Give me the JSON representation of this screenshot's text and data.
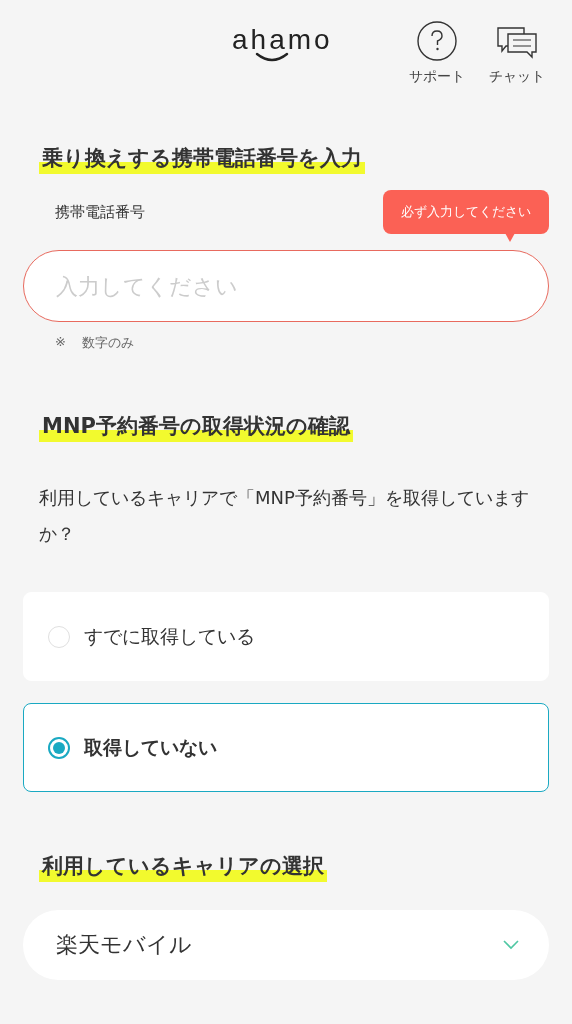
{
  "header": {
    "logo": "ahamo",
    "actions": [
      {
        "kind": "support",
        "label": "サポート"
      },
      {
        "kind": "chat",
        "label": "チャット"
      }
    ]
  },
  "phone_section": {
    "heading": "乗り換えする携帯電話番号を入力",
    "field_label": "携帯電話番号",
    "error_tooltip": "必ず入力してください",
    "placeholder": "入力してください",
    "note_mark": "※",
    "note": "数字のみ"
  },
  "mnp_section": {
    "heading": "MNP予約番号の取得状況の確認",
    "question": "利用しているキャリアで「MNP予約番号」を取得していますか？",
    "options": [
      {
        "label": "すでに取得している",
        "selected": false
      },
      {
        "label": "取得していない",
        "selected": true
      }
    ]
  },
  "carrier_section": {
    "heading": "利用しているキャリアの選択",
    "value": "楽天モバイル"
  }
}
